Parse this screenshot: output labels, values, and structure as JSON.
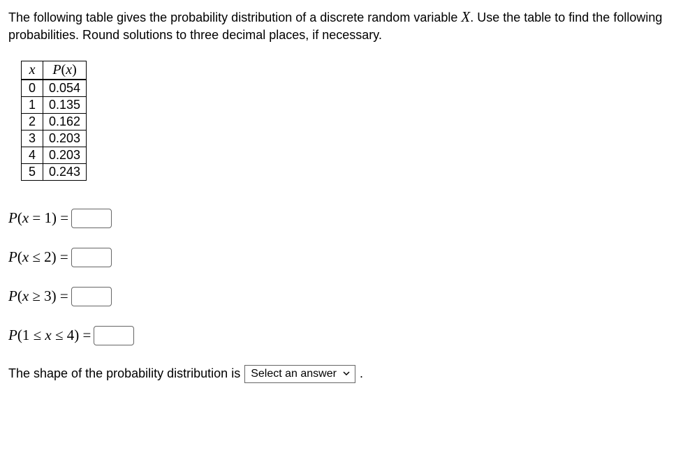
{
  "intro": {
    "before_x": "The following table gives the probability distribution of a discrete random variable ",
    "x_symbol": "X",
    "after_x": ". Use the table to find the following probabilities. Round solutions to three decimal places, if necessary."
  },
  "table": {
    "header_x": "x",
    "header_px_before": "P",
    "header_px_paren_open": "(",
    "header_px_var": "x",
    "header_px_paren_close": ")",
    "rows": [
      {
        "x": "0",
        "p": "0.054"
      },
      {
        "x": "1",
        "p": "0.135"
      },
      {
        "x": "2",
        "p": "0.162"
      },
      {
        "x": "3",
        "p": "0.203"
      },
      {
        "x": "4",
        "p": "0.203"
      },
      {
        "x": "5",
        "p": "0.243"
      }
    ]
  },
  "questions": {
    "q1_label": "P(x = 1) =",
    "q2_label": "P(x ≤ 2) =",
    "q3_label": "P(x ≥ 3) =",
    "q4_label": "P(1 ≤ x ≤ 4) ="
  },
  "shape": {
    "before": "The shape of the probability distribution is",
    "select_placeholder": "Select an answer",
    "after": "."
  }
}
